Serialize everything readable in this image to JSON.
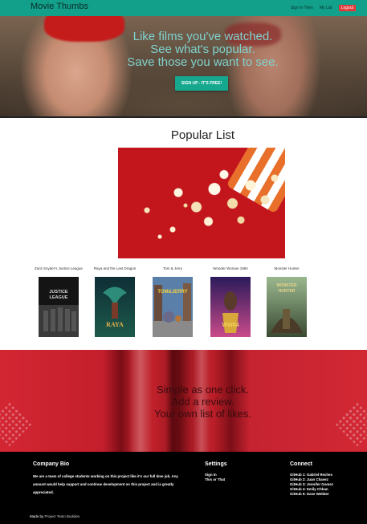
{
  "nav": {
    "brand": "Movie Thumbs",
    "links": [
      "Sign in Then",
      "My List"
    ],
    "logout": "Logout"
  },
  "hero": {
    "headline": [
      "Like films you've watched.",
      "See what's popular.",
      "Save those you want to see."
    ],
    "cta": "SIGN UP - IT'S FREE!"
  },
  "popular": {
    "title": "Popular List",
    "movies": [
      {
        "title": "Zack Snyder's Justice League",
        "poster_label": "JUSTICE LEAGUE",
        "colors": [
          "#1c1c1c",
          "#6b6b6b"
        ]
      },
      {
        "title": "Raya and the Last Dragon",
        "poster_label": "RAYA",
        "colors": [
          "#0f3a3d",
          "#d9a13a"
        ]
      },
      {
        "title": "Tom & Jerry",
        "poster_label": "TOM & JERRY",
        "colors": [
          "#2a5a8a",
          "#d97b3a"
        ]
      },
      {
        "title": "Wonder Woman 1984",
        "poster_label": "WW84",
        "colors": [
          "#2a1a4a",
          "#e6b84a"
        ]
      },
      {
        "title": "Monster Hunter",
        "poster_label": "MONSTER HUNTER",
        "colors": [
          "#3a5a3a",
          "#c9b36a"
        ]
      }
    ]
  },
  "seat": {
    "lines": [
      "Simple as one click.",
      "Add a review.",
      "Your own list of likes."
    ]
  },
  "footer": {
    "bio_title": "Company Bio",
    "bio_text": "We are a team of college students working on this project like it's our full time job. Any amount would help support and continue development on this project and is greatly appreciated.",
    "settings_title": "Settings",
    "settings_items": [
      "Sign In",
      "This or That"
    ],
    "connect_title": "Connect",
    "connect_items": [
      "GitHub 1: Gabriel Reches",
      "GitHub 2: Juan Chavez",
      "GitHub 3: Jennifer Gomez",
      "GitHub 4: Emily Chhan",
      "GitHub 5: Dave Webber"
    ],
    "made_by": "Made by",
    "team": "Project Team Buddies"
  }
}
